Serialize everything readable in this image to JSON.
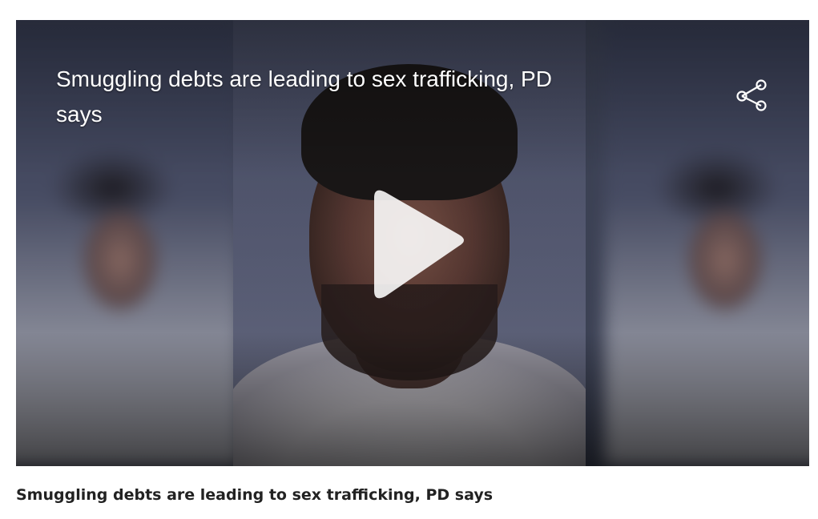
{
  "video": {
    "title": "Smuggling debts are leading to sex trafficking, PD says",
    "share_icon": "share-icon",
    "play_icon": "play-icon",
    "overlay_text_color": "#ffffff"
  },
  "caption": {
    "text": "Smuggling debts are leading to sex trafficking, PD says",
    "color": "#222222"
  }
}
